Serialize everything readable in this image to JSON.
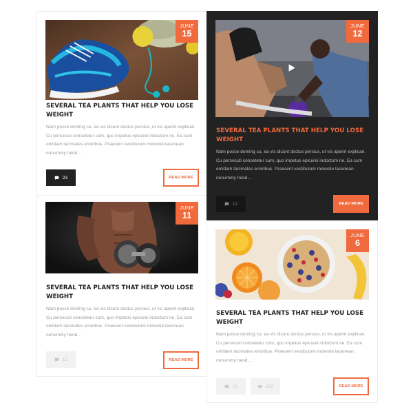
{
  "accent_color": "#f06a3d",
  "posts": [
    {
      "month": "JUNE",
      "day": "15",
      "image": "sneakers-and-fitness-gear",
      "title": "SEVERAL TEA PLANTS THAT HELP YOU LOSE WEIGHT",
      "excerpt": "Nam posse doming cu, ea vis dicunt doctus persius, ut vis aperiri explicari. Cu persecuti consetetur cum, quo impetus epicurei indoctum ne. Ea cum omittam tacimates erroribus. Praesent vestibulum molestie lacenean nonummy hend...",
      "comments": "23",
      "read_more": "READ MORE"
    },
    {
      "month": "JUNE",
      "day": "12",
      "image": "gym-workout-video",
      "title": "SEVERAL TEA PLANTS THAT HELP YOU LOSE WEIGHT",
      "excerpt": "Nam posse doming cu, ea vis dicunt doctus persius, ut vis aperiri explicari. Cu persecuti consetetur cum, quo impetus epicurei indoctum ne. Ea cum omittam tacimates erroribus. Praesent vestibulum molestie lacenean nonummy hend...",
      "comments": "12",
      "read_more": "READ MORE"
    },
    {
      "month": "JUNE",
      "day": "11",
      "image": "man-lifting-dumbbell",
      "title": "SEVERAL TEA PLANTS THAT HELP YOU LOSE WEIGHT",
      "excerpt": "Nam posse doming cu, ea vis dicunt doctus persius, ut vis aperiri explicari. Cu persecuti consetetur cum, quo impetus epicurei indoctum ne. Ea cum omittam tacimates erroribus. Praesent vestibulum molestie lacenean nonummy hend...",
      "comments": "12",
      "read_more": "READ MORE"
    },
    {
      "month": "JUNE",
      "day": "6",
      "image": "fruit-and-cereal-breakfast",
      "title": "SEVERAL TEA PLANTS THAT HELP YOU LOSE WEIGHT",
      "excerpt": "Nam posse doming cu, ea vis dicunt doctus persius, ut vis aperiri explicari. Cu persecuti consetetur cum, quo impetus epicurei indoctum ne. Ea cum omittam tacimates erroribus. Praesent vestibulum molestie lacenean nonummy hend...",
      "comments": "12",
      "likes": "133",
      "read_more": "READ MORE"
    }
  ]
}
